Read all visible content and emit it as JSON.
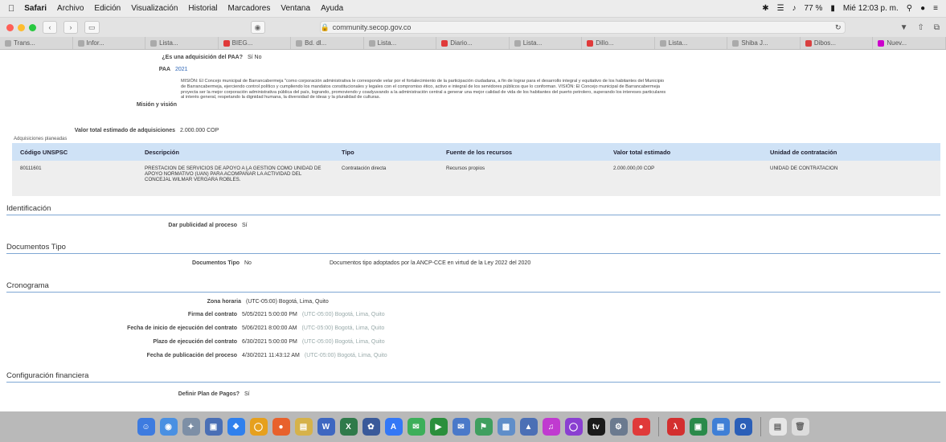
{
  "menubar": {
    "app": "Safari",
    "items": [
      "Archivo",
      "Edición",
      "Visualización",
      "Historial",
      "Marcadores",
      "Ventana",
      "Ayuda"
    ],
    "battery": "77 %",
    "datetime": "Mié 12:03 p. m."
  },
  "toolbar": {
    "address": "community.secop.gov.co"
  },
  "tabs": [
    "Trans...",
    "Infor...",
    "Lista...",
    "BIEG...",
    "Bd. dl...",
    "Lista...",
    "Diario...",
    "Lista...",
    "Dillo...",
    "Lista...",
    "Shiba J...",
    "Dibos...",
    "Nuev..."
  ],
  "form": {
    "paa_question_label": "¿Es una adquisición del PAA?",
    "paa_answer": "Sí  No",
    "paa_label": "PAA",
    "paa_value": "2021",
    "mision_label": "Misión y visión",
    "mision_text": "MISIÓN: El Concejo municipal de Barrancabermeja \"como corporación administrativa le corresponde velar por el fortalecimiento de la participación ciudadana, a fin de lograr para el desarrollo integral y equitativo de los habitantes del Municipio de Barrancabermeja, ejerciendo control político y cumpliendo los mandatos constitucionales y legales con el compromiso ético, activo e integral de los servidores públicos que lo conforman. VISIÓN: El Concejo municipal de Barrancabermeja proyecta ser la mejor corporación administrativa pública del país, logrando, promoviendo y coadyuvando a la administración central a generar una mejor calidad de vida de los habitantes del puerto petrolero, superando los intereses particulares al interés general, respetando la dignidad humana, la diversidad de ideas y la pluralidad de culturas.",
    "valor_label": "Valor total estimado de adquisiciones",
    "valor_value": "2.000.000 COP"
  },
  "table": {
    "caption": "Adquisiciones planeadas",
    "headers": [
      "Código UNSPSC",
      "Descripción",
      "Tipo",
      "Fuente de los recursos",
      "Valor total estimado",
      "Unidad de contratación"
    ],
    "rows": [
      [
        "80111601",
        "PRESTACION DE SERVICIOS DE APOYO A LA GESTION COMO UNIDAD DE APOYO NORMATIVO (UAN) PARA ACOMPAÑAR LA ACTIVIDAD DEL CONCEJAL WILMAR VERGARA ROBLES.",
        "Contratación directa",
        "Recursos propios",
        "2.000.000,00 COP",
        "UNIDAD DE CONTRATACION"
      ]
    ]
  },
  "identificacion": {
    "title": "Identificación",
    "publicidad_label": "Dar publicidad al proceso",
    "publicidad_value": "Sí"
  },
  "documentos": {
    "title": "Documentos Tipo",
    "label": "Documentos Tipo",
    "value": "No",
    "note": "Documentos tipo adoptados por la ANCP-CCE en virtud de la Ley 2022 del 2020"
  },
  "cronograma": {
    "title": "Cronograma",
    "zona_label": "Zona horaria",
    "zona_value": "(UTC-05:00) Bogotá, Lima, Quito",
    "tz_note": "(UTC-05:00) Bogotá, Lima, Quito",
    "items": [
      {
        "label": "Firma del contrato",
        "value": "5/05/2021 5:00:00 PM"
      },
      {
        "label": "Fecha de inicio de ejecución del contrato",
        "value": "5/06/2021 8:00:00 AM"
      },
      {
        "label": "Plazo de ejecución del contrato",
        "value": "6/30/2021 5:00:00 PM"
      },
      {
        "label": "Fecha de publicación del proceso",
        "value": "4/30/2021 11:43:12 AM"
      }
    ]
  },
  "financiera": {
    "title": "Configuración financiera",
    "plan_label": "Definir Plan de Pagos?",
    "plan_value": "Sí"
  }
}
